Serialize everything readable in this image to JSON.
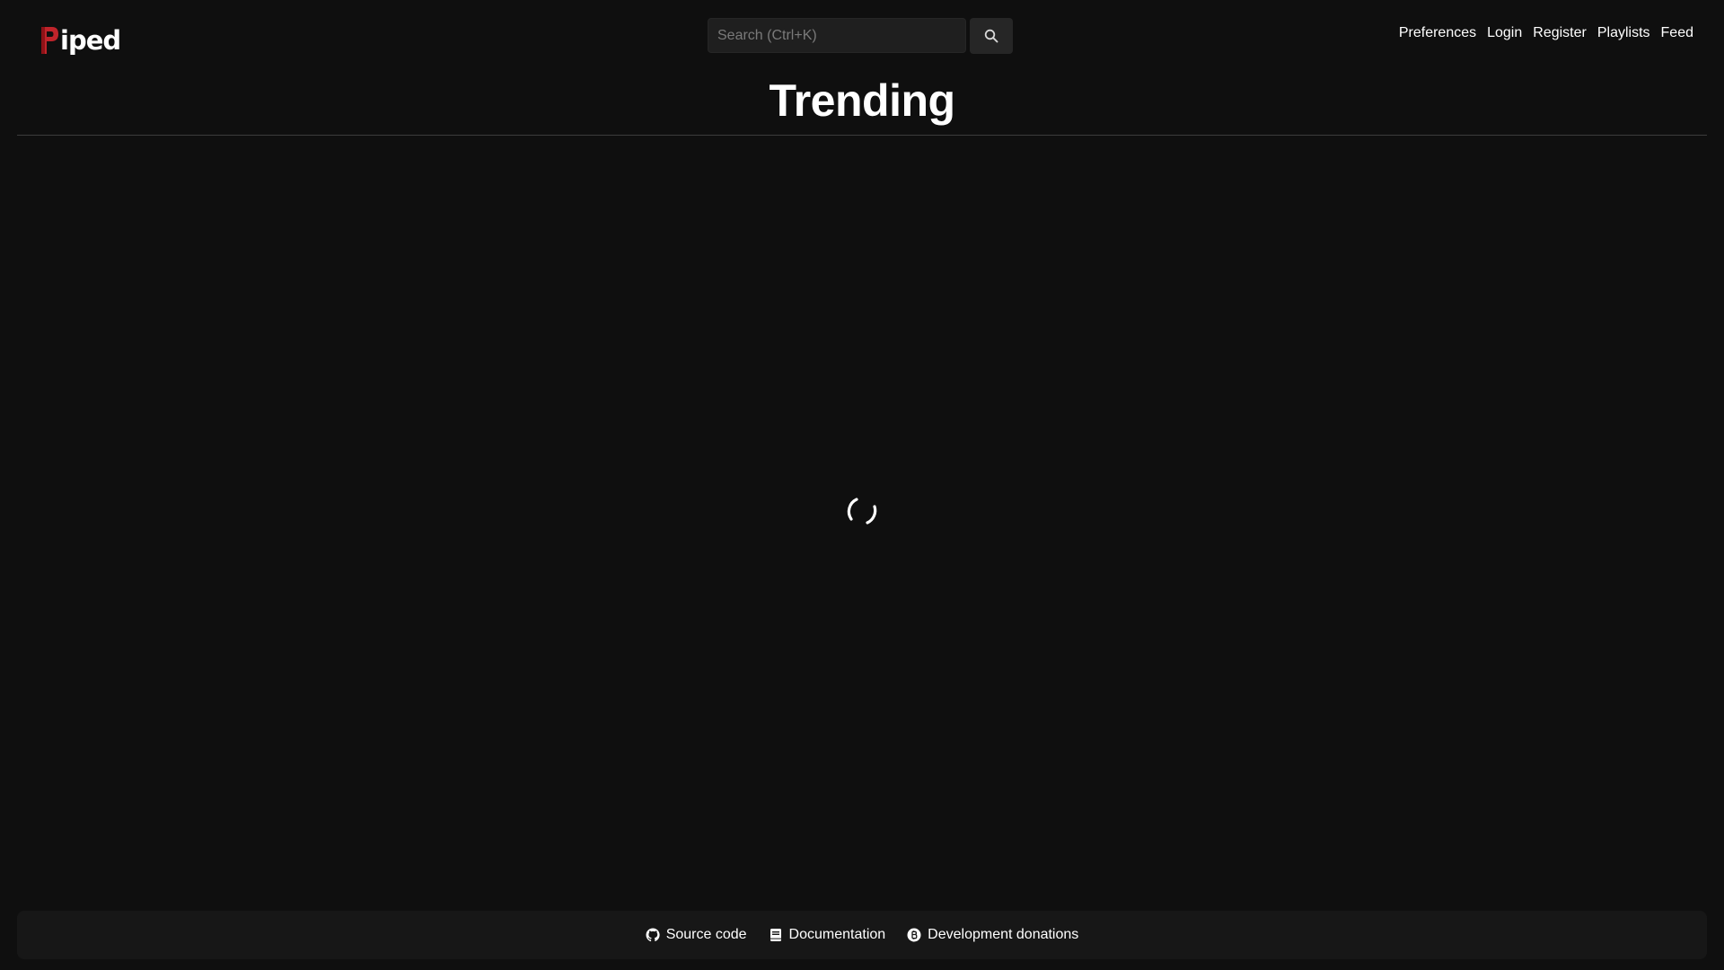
{
  "header": {
    "logo_text": "iped",
    "search": {
      "placeholder": "Search (Ctrl+K)",
      "value": "",
      "button_icon": "search-icon"
    },
    "nav": [
      {
        "label": "Preferences"
      },
      {
        "label": "Login"
      },
      {
        "label": "Register"
      },
      {
        "label": "Playlists"
      },
      {
        "label": "Feed"
      }
    ]
  },
  "main": {
    "title": "Trending",
    "loading_icon": "loading-spinner-icon"
  },
  "footer": {
    "links": [
      {
        "label": "Source code",
        "icon": "github-icon"
      },
      {
        "label": "Documentation",
        "icon": "book-icon"
      },
      {
        "label": "Development donations",
        "icon": "bitcoin-icon"
      }
    ]
  },
  "colors": {
    "background": "#0f0f0f",
    "surface": "#171717",
    "input": "#1f1f1f",
    "logo_red": "#c0242b",
    "text": "#ffffff"
  }
}
